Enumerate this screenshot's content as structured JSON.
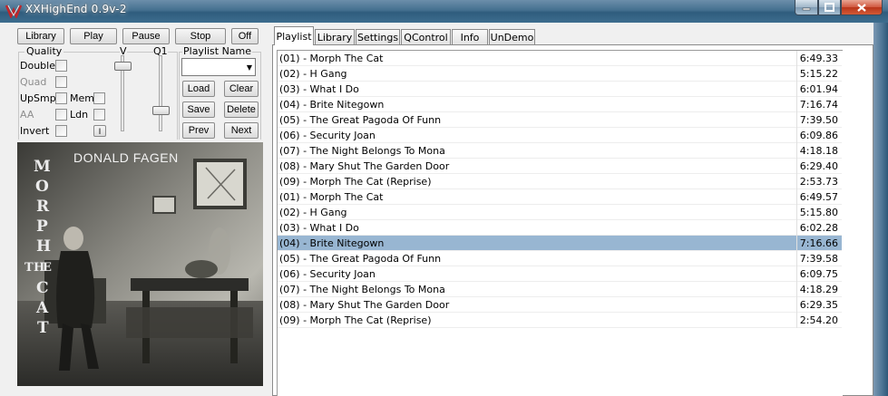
{
  "window": {
    "title": "XXHighEnd 0.9v-2"
  },
  "controls": {
    "library": "Library",
    "play": "Play",
    "pause": "Pause",
    "stop": "Stop",
    "off": "Off"
  },
  "quality": {
    "group_label": "Quality",
    "v_label": "V",
    "q1_label": "Q1",
    "double": "Double",
    "quad": "Quad",
    "upsmp": "UpSmp",
    "mem": "Mem",
    "aa": "AA",
    "ldn": "Ldn",
    "invert": "Invert",
    "info_btn": "I"
  },
  "playlist_name": {
    "label": "Playlist Name",
    "value": "",
    "load": "Load",
    "clear": "Clear",
    "save": "Save",
    "delete": "Delete",
    "prev": "Prev",
    "next": "Next"
  },
  "album": {
    "artist": "DONALD FAGEN",
    "title_letters": [
      "M",
      "O",
      "R",
      "P",
      "H",
      "T",
      "H",
      "E",
      "C",
      "A",
      "T"
    ]
  },
  "tabs": [
    "Playlist",
    "Library",
    "Settings",
    "QControl",
    "Info",
    "UnDemo"
  ],
  "playlist": [
    {
      "title": "(01) - Morph The Cat",
      "duration": "6:49.33"
    },
    {
      "title": "(02) - H Gang",
      "duration": "5:15.22"
    },
    {
      "title": "(03) - What I Do",
      "duration": "6:01.94"
    },
    {
      "title": "(04) - Brite Nitegown",
      "duration": "7:16.74"
    },
    {
      "title": "(05) - The Great Pagoda Of Funn",
      "duration": "7:39.50"
    },
    {
      "title": "(06) - Security Joan",
      "duration": "6:09.86"
    },
    {
      "title": "(07) - The Night Belongs To Mona",
      "duration": "4:18.18"
    },
    {
      "title": "(08) - Mary Shut The Garden Door",
      "duration": "6:29.40"
    },
    {
      "title": "(09) - Morph The Cat (Reprise)",
      "duration": "2:53.73"
    },
    {
      "title": "(01) - Morph The Cat",
      "duration": "6:49.57"
    },
    {
      "title": "(02) - H Gang",
      "duration": "5:15.80"
    },
    {
      "title": "(03) - What I Do",
      "duration": "6:02.28"
    },
    {
      "title": "(04) - Brite Nitegown",
      "duration": "7:16.66"
    },
    {
      "title": "(05) - The Great Pagoda Of Funn",
      "duration": "7:39.58"
    },
    {
      "title": "(06) - Security Joan",
      "duration": "6:09.75"
    },
    {
      "title": "(07) - The Night Belongs To Mona",
      "duration": "4:18.29"
    },
    {
      "title": "(08) - Mary Shut The Garden Door",
      "duration": "6:29.35"
    },
    {
      "title": "(09) - Morph The Cat (Reprise)",
      "duration": "2:54.20"
    }
  ],
  "selected_index": 12,
  "colors": {
    "selection": "#98b6d2",
    "titlebar": "#44708f"
  },
  "icons": {
    "app": "xx-logo-icon",
    "minimize": "minimize-icon",
    "maximize": "maximize-icon",
    "close": "close-icon",
    "dropdown": "chevron-down-icon"
  }
}
